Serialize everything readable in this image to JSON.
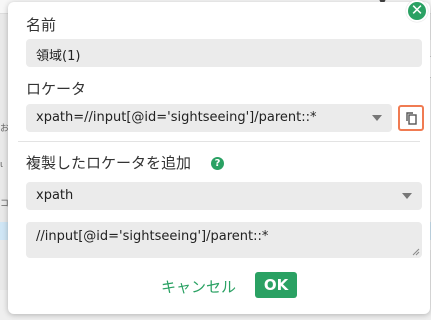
{
  "background": {
    "right_input_fragment": "入",
    "left_fragments": [
      "お",
      "ι",
      "コ"
    ]
  },
  "dialog": {
    "close_glyph": "✕",
    "name": {
      "label": "名前",
      "value": "領域(1)"
    },
    "locator": {
      "label": "ロケータ",
      "value": "xpath=//input[@id='sightseeing']/parent::*"
    },
    "add_duplicate": {
      "label": "複製したロケータを追加",
      "help_glyph": "?",
      "type_value": "xpath",
      "expression_value": "//input[@id='sightseeing']/parent::*"
    },
    "buttons": {
      "cancel": "キャンセル",
      "ok": "OK"
    }
  },
  "colors": {
    "accent": "#2aa163",
    "highlight": "#f07b52",
    "field_bg": "#ebebeb"
  },
  "icons": {
    "close": "close-icon",
    "copy": "copy-icon",
    "help": "help-icon",
    "caret": "chevron-down-icon"
  }
}
